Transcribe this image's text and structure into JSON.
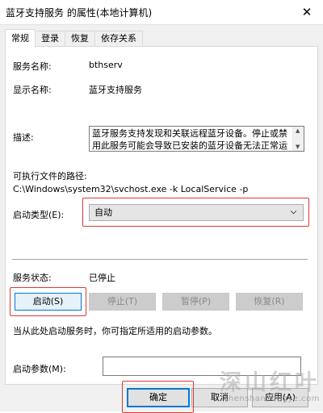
{
  "window": {
    "title": "蓝牙支持服务 的属性(本地计算机)",
    "close_glyph": "✕"
  },
  "tabs": [
    {
      "label": "常规",
      "active": true
    },
    {
      "label": "登录",
      "active": false
    },
    {
      "label": "恢复",
      "active": false
    },
    {
      "label": "依存关系",
      "active": false
    }
  ],
  "general": {
    "service_name_label": "服务名称:",
    "service_name_value": "bthserv",
    "display_name_label": "显示名称:",
    "display_name_value": "蓝牙支持服务",
    "description_label": "描述:",
    "description_value": "蓝牙服务支持发现和关联远程蓝牙设备。停止或禁用此服务可能会导致已安装的蓝牙设备无法正常运行，并使新设备无法被发现或关联。",
    "exe_path_label": "可执行文件的路径:",
    "exe_path_value": "C:\\Windows\\system32\\svchost.exe -k LocalService -p",
    "startup_type_label": "启动类型(E):",
    "startup_type_value": "自动",
    "status_label": "服务状态:",
    "status_value": "已停止",
    "buttons": {
      "start": "启动(S)",
      "stop": "停止(T)",
      "pause": "暂停(P)",
      "resume": "恢复(R)"
    },
    "hint": "当从此处启动服务时，你可指定所适用的启动参数。",
    "params_label": "启动参数(M):",
    "params_value": ""
  },
  "footer": {
    "ok": "确定",
    "cancel": "取消",
    "apply": "应用(A)"
  },
  "watermark": {
    "cn": "深山红叶",
    "en": "shenshanhongye.com"
  },
  "colors": {
    "highlight_box": "#d93a3a",
    "focus_blue": "#0078d7"
  }
}
